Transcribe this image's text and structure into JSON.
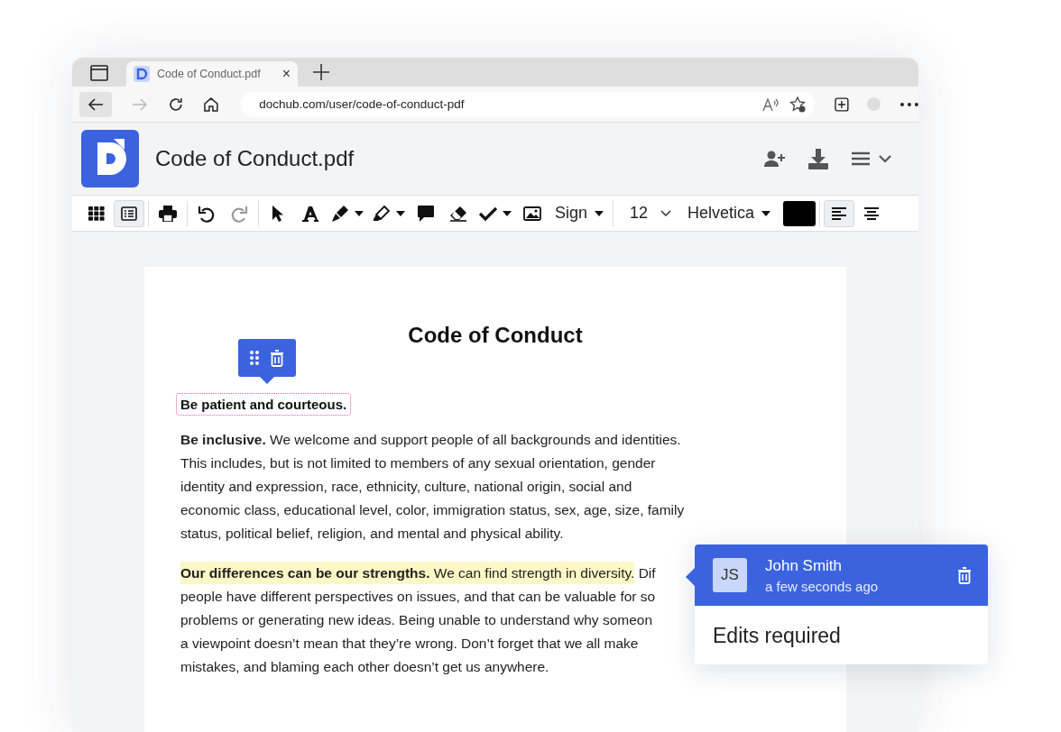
{
  "browser": {
    "tab": {
      "title": "Code of Conduct.pdf",
      "close": "×"
    },
    "url": "dochub.com/user/code-of-conduct-pdf",
    "forward_disabled": true
  },
  "header": {
    "title": "Code of Conduct.pdf"
  },
  "toolbar": {
    "view_modes": [
      {
        "selected": false
      },
      {
        "selected": true
      }
    ],
    "history": [
      {
        "disabled": false
      },
      {
        "disabled": true
      }
    ],
    "sign_label": "Sign",
    "font_size": "12",
    "font_family": "Helvetica",
    "color": "#000000",
    "alignments": [
      {
        "selected": true
      },
      {
        "selected": false
      }
    ]
  },
  "document": {
    "title": "Code of Conduct",
    "selected_text": "Be patient and courteous.",
    "paragraphs": [
      {
        "lines": [
          "**Be inclusive.** We welcome and support people of all backgrounds and identities.",
          "This includes, but is not limited to members of any sexual orientation, gender",
          "identity and expression, race, ethnicity, culture, national origin, social and",
          "economic class, educational level, color, immigration status, sex, age, size, family",
          "status, political belief, religion, and mental and physical ability."
        ]
      },
      {
        "highlighted": "**Our differences can be our strengths.** We can find strength in diversity.",
        "lines": [
          " Dif",
          "people have different perspectives on issues, and that can be valuable for so",
          "problems or generating new ideas. Being unable to understand why someon",
          "a viewpoint doesn’t mean that they’re wrong. Don’t forget that we all make",
          "mistakes, and blaming each other doesn’t get us anywhere."
        ]
      }
    ]
  },
  "comment": {
    "initials": "JS",
    "author": "John Smith",
    "time": "a few seconds ago",
    "text": "Edits required"
  }
}
